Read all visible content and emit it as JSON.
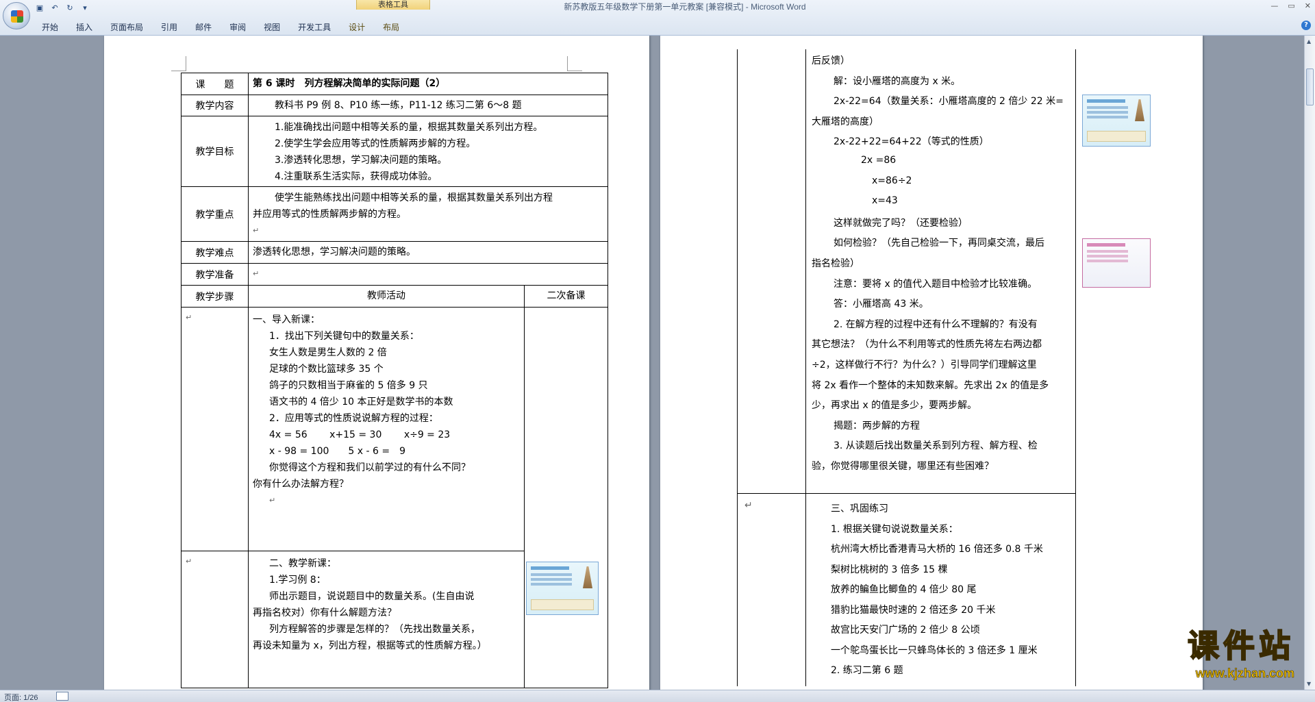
{
  "window": {
    "title": "新苏教版五年级数学下册第一单元教案 [兼容模式] - Microsoft Word",
    "context_group": "表格工具"
  },
  "ribbon": {
    "tabs": [
      "开始",
      "插入",
      "页面布局",
      "引用",
      "邮件",
      "审阅",
      "视图",
      "开发工具",
      "设计",
      "布局"
    ]
  },
  "left_page": {
    "rows": {
      "topic_label": "课　　题",
      "topic_value": "第 6 课时　列方程解决简单的实际问题（2）",
      "content_label": "教学内容",
      "content_value": "教科书 P9 例 8、P10 练一练，P11-12 练习二第 6～8 题",
      "goals_label": "教学目标",
      "goals": [
        "1.能准确找出问题中相等关系的量，根据其数量关系列出方程。",
        "2.使学生学会应用等式的性质解两步解的方程。",
        "3.渗透转化思想，学习解决问题的策略。",
        "4.注重联系生活实际，获得成功体验。"
      ],
      "key_label": "教学重点",
      "key_lines": [
        "使学生能熟练找出问题中相等关系的量，根据其数量关系列出方程",
        "并应用等式的性质解两步解的方程。"
      ],
      "difficulty_label": "教学难点",
      "difficulty_value": "渗透转化思想，学习解决问题的策略。",
      "prep_label": "教学准备",
      "steps_label": "教学步骤",
      "teacher_header": "教师活动",
      "backup_header": "二次备课"
    },
    "intro_lines": [
      "一、导入新课：",
      "1．找出下列关键句中的数量关系：",
      "女生人数是男生人数的 2 倍",
      "足球的个数比篮球多 35 个",
      "鸽子的只数相当于麻雀的 5 倍多 9 只",
      "语文书的 4 倍少 10 本正好是数学书的本数",
      "2．应用等式的性质说说解方程的过程：",
      "4x = 56　　 x+15 = 30　　 x÷9 = 23",
      "x - 98 = 100　　5 x - 6 =　9",
      "你觉得这个方程和我们以前学过的有什么不同？",
      "你有什么办法解方程？"
    ],
    "new_lines": [
      "二、教学新课：",
      "1.学习例 8：",
      "师出示题目，说说题目中的数量关系。(生自由说",
      "再指名校对）你有什么解题方法？",
      "列方程解答的步骤是怎样的？（先找出数量关系，",
      "再设未知量为 x，列出方程，根据等式的性质解方程。）"
    ]
  },
  "right_page": {
    "upper_lines": [
      "后反馈）",
      "解：设小雁塔的高度为 x 米。",
      "2x-22=64（数量关系：小雁塔高度的 2 倍少 22 米=",
      "大雁塔的高度）",
      "2x-22+22=64+22（等式的性质）",
      "2x =86",
      "x=86÷2",
      "x=43",
      "这样就做完了吗？（还要检验）",
      "如何检验？（先自己检验一下，再同桌交流，最后",
      "指名检验）",
      "注意：要将 x 的值代入题目中检验才比较准确。",
      "答：小雁塔高 43 米。",
      "2. 在解方程的过程中还有什么不理解的？有没有",
      "其它想法？（为什么不利用等式的性质先将左右两边都",
      "÷2，这样做行不行？为什么？）引导同学们理解这里",
      "将 2x 看作一个整体的未知数来解。先求出 2x 的值是多",
      "少，再求出 x 的值是多少，要两步解。",
      "揭题：两步解的方程",
      "3. 从读题后找出数量关系到列方程、解方程、检",
      "验，你觉得哪里很关键，哪里还有些困难？"
    ],
    "lower_lines": [
      "三、巩固练习",
      "1. 根据关键句说说数量关系：",
      "杭州湾大桥比香港青马大桥的 16 倍还多 0.8 千米",
      "梨树比桃树的 3 倍多 15 棵",
      "放养的鳊鱼比鲫鱼的 4 倍少 80 尾",
      "猎豹比猫最快时速的 2 倍还多 20 千米",
      "故宫比天安门广场的 2 倍少 8 公顷",
      "一个鸵鸟蛋长比一只蜂鸟体长的 3 倍还多 1 厘米",
      "2. 练习二第 6 题"
    ]
  },
  "watermark": {
    "main": "课件站",
    "sub": "www.kjzhan.com"
  },
  "status": {
    "page": "页面: 1/26"
  }
}
